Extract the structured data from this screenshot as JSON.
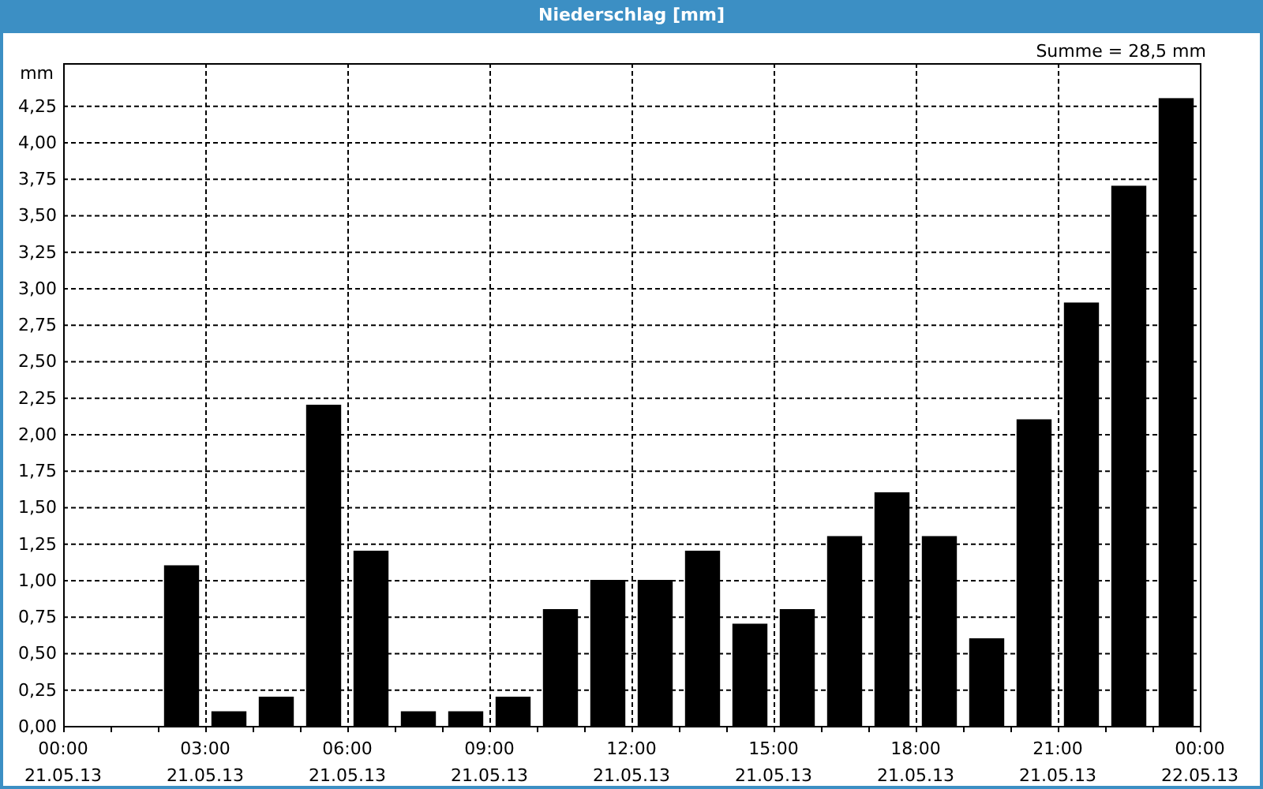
{
  "window": {
    "title": "Niederschlag [mm]"
  },
  "summary": "Summe = 28,5 mm",
  "chart_data": {
    "type": "bar",
    "ylabel": "mm",
    "grid": true,
    "categories": [
      null,
      null,
      null,
      null,
      null,
      null,
      null,
      null,
      null,
      null,
      null,
      null,
      null,
      null,
      null,
      null,
      null,
      null,
      null,
      null,
      null,
      null,
      null,
      null
    ],
    "series": [
      {
        "color": "#000000",
        "values": [
          0,
          0,
          1.1,
          0.1,
          0.2,
          2.2,
          1.2,
          0.1,
          0.1,
          0.2,
          0.8,
          1.0,
          1.0,
          1.2,
          0.7,
          0.8,
          1.3,
          1.6,
          1.3,
          0.6,
          2.1,
          2.9,
          3.7,
          4.3
        ]
      }
    ],
    "ylim": [
      0,
      4.54
    ],
    "yticks": [
      {
        "value": 0,
        "label": "0,00"
      },
      {
        "value": 0.25,
        "label": "0,25"
      },
      {
        "value": 0.5,
        "label": "0,50"
      },
      {
        "value": 0.75,
        "label": "0,75"
      },
      {
        "value": 1,
        "label": "1,00"
      },
      {
        "value": 1.25,
        "label": "1,25"
      },
      {
        "value": 1.5,
        "label": "1,50"
      },
      {
        "value": 1.75,
        "label": "1,75"
      },
      {
        "value": 2,
        "label": "2,00"
      },
      {
        "value": 2.25,
        "label": "2,25"
      },
      {
        "value": 2.5,
        "label": "2,50"
      },
      {
        "value": 2.75,
        "label": "2,75"
      },
      {
        "value": 3,
        "label": "3,00"
      },
      {
        "value": 3.25,
        "label": "3,25"
      },
      {
        "value": 3.5,
        "label": "3,50"
      },
      {
        "value": 3.75,
        "label": "3,75"
      },
      {
        "value": 4,
        "label": "4,00"
      },
      {
        "value": 4.25,
        "label": "4,25"
      }
    ]
  },
  "time_axis_labels": [
    {
      "time": "00:00",
      "date": "21.05.13"
    },
    {
      "time": "03:00",
      "date": "21.05.13"
    },
    {
      "time": "06:00",
      "date": "21.05.13"
    },
    {
      "time": "09:00",
      "date": "21.05.13"
    },
    {
      "time": "12:00",
      "date": "21.05.13"
    },
    {
      "time": "15:00",
      "date": "21.05.13"
    },
    {
      "time": "18:00",
      "date": "21.05.13"
    },
    {
      "time": "21:00",
      "date": "21.05.13"
    },
    {
      "time": "00:00",
      "date": "22.05.13"
    }
  ]
}
